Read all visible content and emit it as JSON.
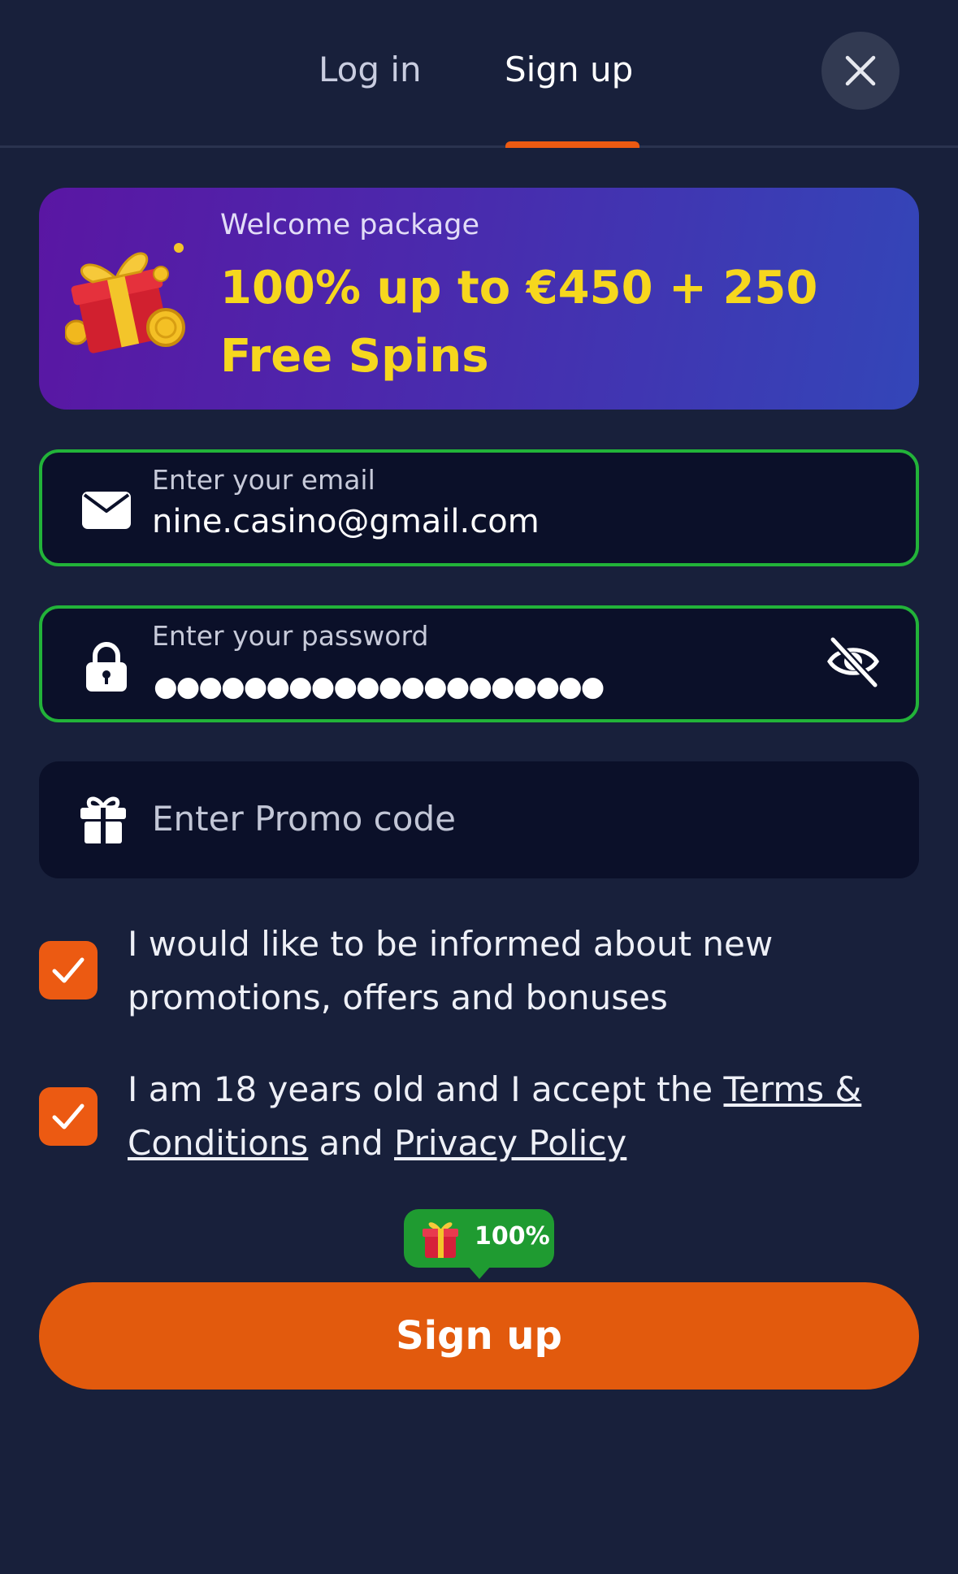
{
  "tabs": {
    "login": "Log in",
    "signup": "Sign up",
    "active": "signup"
  },
  "icons": {
    "close": "close-icon",
    "gift_banner": "gift-box-icon",
    "email": "envelope-icon",
    "password": "lock-icon",
    "visibility": "eye-slash-icon",
    "promo": "gift-icon",
    "checkbox": "checkmark-icon"
  },
  "banner": {
    "subtitle": "Welcome package",
    "title": "100% up to €450 + 250 Free Spins"
  },
  "form": {
    "email": {
      "label": "Enter your email",
      "value": "nine.casino@gmail.com",
      "valid": true
    },
    "password": {
      "label": "Enter your password",
      "masked_value": "●●●●●●●●●●●●●●●●●●●●",
      "valid": true
    },
    "promo": {
      "placeholder": "Enter Promo code",
      "value": ""
    }
  },
  "checkboxes": {
    "promotions": {
      "checked": true,
      "text": "I would like to be informed about new promotions, offers and bonuses"
    },
    "terms": {
      "checked": true,
      "text_before": "I am 18 years old and I accept the ",
      "terms_link": "Terms & Conditions",
      "text_between": " and ",
      "privacy_link": "Privacy Policy"
    }
  },
  "bonus_badge": {
    "text": "100%"
  },
  "submit": {
    "label": "Sign up"
  },
  "colors": {
    "background": "#18203b",
    "accent": "#ec5a12",
    "valid_border": "#22b339",
    "banner_text": "#f6d71e",
    "badge": "#1f9b31"
  }
}
